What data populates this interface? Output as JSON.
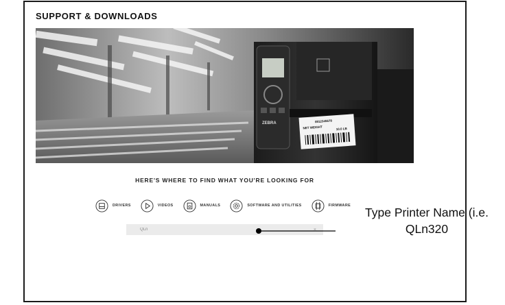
{
  "page": {
    "section_title": "SUPPORT & DOWNLOADS",
    "headline": "HERE'S WHERE TO FIND WHAT YOU'RE LOOKING FOR"
  },
  "printer_label": {
    "line1": "0812345678",
    "line2": "NET WEIGHT",
    "line3": "10.0 LB"
  },
  "categories": [
    {
      "label": "DRIVERS",
      "icon": "printer-icon"
    },
    {
      "label": "VIDEOS",
      "icon": "play-icon"
    },
    {
      "label": "MANUALS",
      "icon": "manual-icon"
    },
    {
      "label": "SOFTWARE AND UTILITIES",
      "icon": "gear-icon"
    },
    {
      "label": "FIRMWARE",
      "icon": "firmware-icon"
    }
  ],
  "search": {
    "value": "QLn",
    "clear_label": "×"
  },
  "callout": {
    "line1": "Type Printer Name (i.e.",
    "line2": "QLn320"
  },
  "colors": {
    "frame": "#1a1a1a",
    "search_bg": "#ebebeb",
    "text": "#222222"
  }
}
